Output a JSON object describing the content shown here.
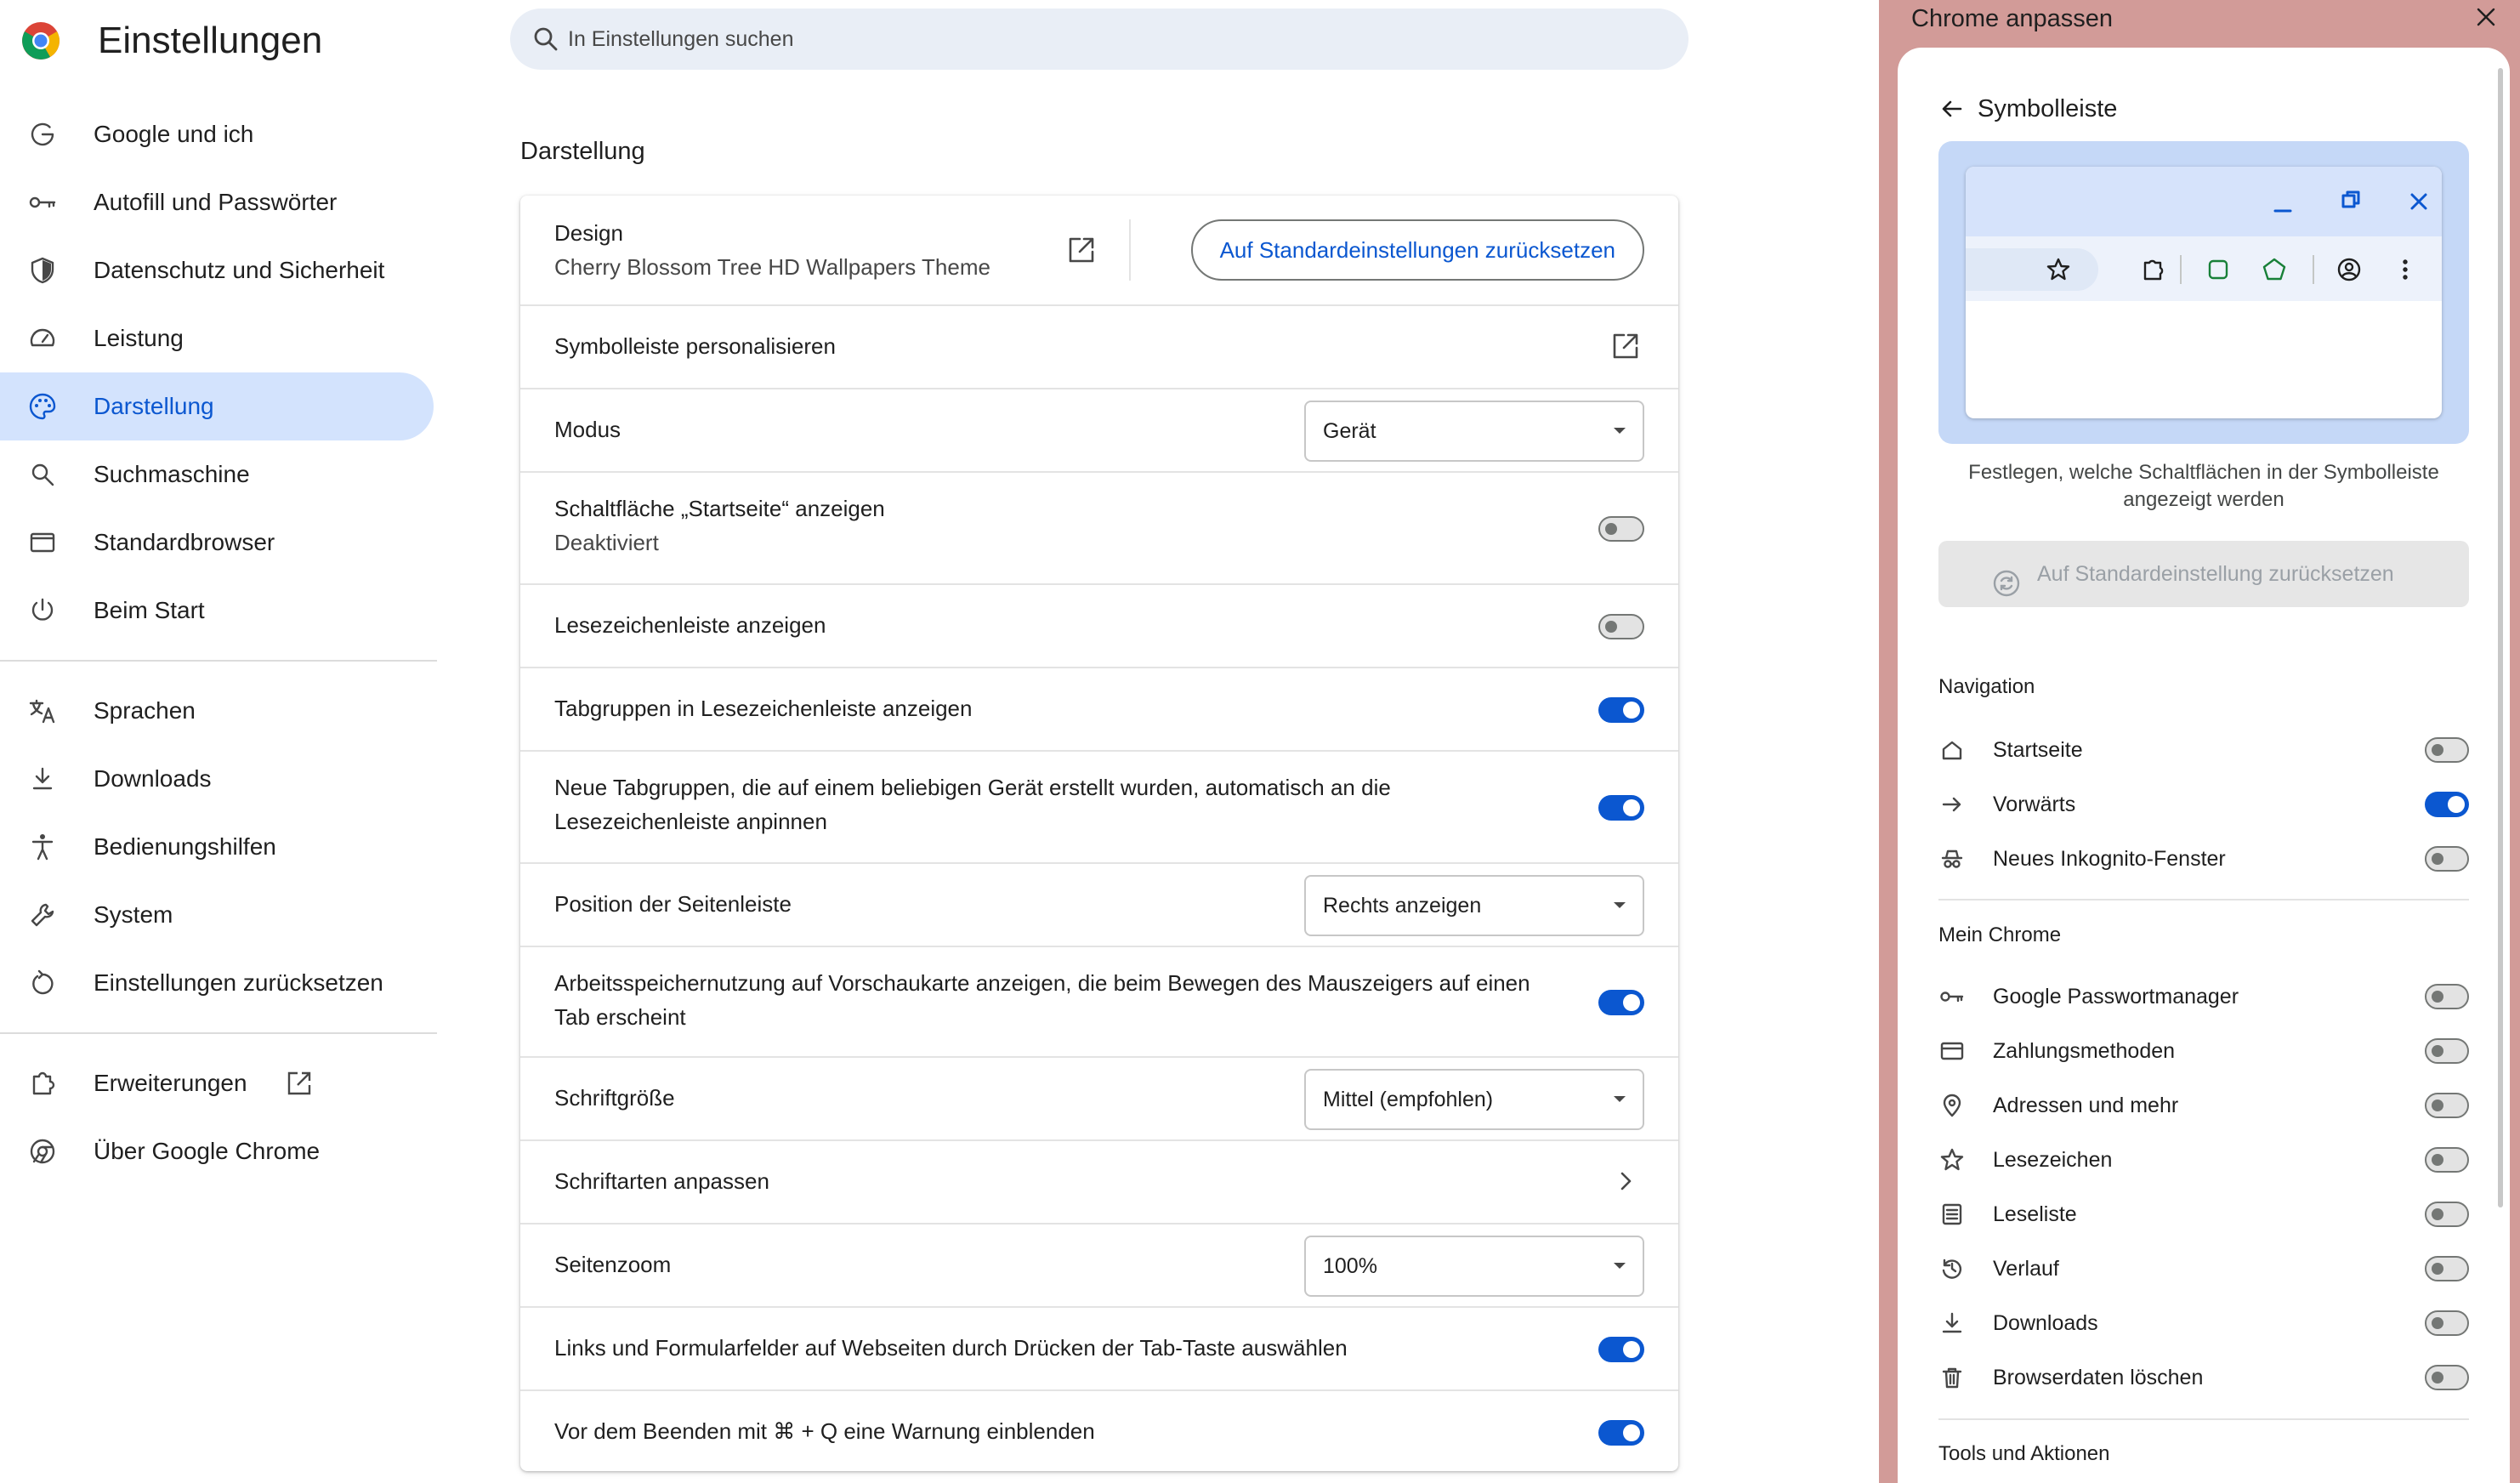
{
  "app": {
    "title": "Einstellungen"
  },
  "search": {
    "placeholder": "In Einstellungen suchen"
  },
  "nav": {
    "items": [
      {
        "label": "Google und ich",
        "icon": "google-g-icon"
      },
      {
        "label": "Autofill und Passwörter",
        "icon": "key-icon"
      },
      {
        "label": "Datenschutz und Sicherheit",
        "icon": "shield-icon"
      },
      {
        "label": "Leistung",
        "icon": "speedometer-icon"
      },
      {
        "label": "Darstellung",
        "icon": "palette-icon",
        "active": true
      },
      {
        "label": "Suchmaschine",
        "icon": "search-icon"
      },
      {
        "label": "Standardbrowser",
        "icon": "browser-window-icon"
      },
      {
        "label": "Beim Start",
        "icon": "power-icon"
      },
      {
        "label": "Sprachen",
        "icon": "translate-icon"
      },
      {
        "label": "Downloads",
        "icon": "download-icon"
      },
      {
        "label": "Bedienungshilfen",
        "icon": "accessibility-icon"
      },
      {
        "label": "System",
        "icon": "wrench-icon"
      },
      {
        "label": "Einstellungen zurücksetzen",
        "icon": "restore-icon"
      },
      {
        "label": "Erweiterungen",
        "icon": "puzzle-icon"
      },
      {
        "label": "Über Google Chrome",
        "icon": "chrome-icon"
      }
    ]
  },
  "main": {
    "section_title": "Darstellung",
    "design": {
      "label": "Design",
      "value": "Cherry Blossom Tree HD Wallpapers Theme",
      "reset_label": "Auf Standardeinstellungen zurücksetzen"
    },
    "toolbar_customize": "Symbolleiste personalisieren",
    "mode": {
      "label": "Modus",
      "value": "Gerät"
    },
    "home_button": {
      "label": "Schaltfläche „Startseite“ anzeigen",
      "sub": "Deaktiviert",
      "on": false
    },
    "bookmarks_bar": {
      "label": "Lesezeichenleiste anzeigen",
      "on": false
    },
    "tab_groups_bar": {
      "label": "Tabgruppen in Lesezeichenleiste anzeigen",
      "on": true
    },
    "pin_tab_groups": {
      "label": "Neue Tabgruppen, die auf einem beliebigen Gerät erstellt wurden, automatisch an die Lesezeichenleiste anpinnen",
      "on": true
    },
    "sidebar_position": {
      "label": "Position der Seitenleiste",
      "value": "Rechts anzeigen"
    },
    "memory_usage": {
      "label": "Arbeitsspeichernutzung auf Vorschaukarte anzeigen, die beim Bewegen des Mauszeigers auf einen Tab erscheint",
      "on": true
    },
    "font_size": {
      "label": "Schriftgröße",
      "value": "Mittel (empfohlen)"
    },
    "custom_fonts": {
      "label": "Schriftarten anpassen"
    },
    "page_zoom": {
      "label": "Seitenzoom",
      "value": "100%"
    },
    "tab_key": {
      "label": "Links und Formularfelder auf Webseiten durch Drücken der Tab-Taste auswählen",
      "on": true
    },
    "quit_warning": {
      "label": "Vor dem Beenden mit ⌘ + Q eine Warnung einblenden",
      "on": true
    }
  },
  "side_panel": {
    "title": "Chrome anpassen",
    "back_label": "Symbolleiste",
    "description": "Festlegen, welche Schaltflächen in der Symbolleiste angezeigt werden",
    "reset_label": "Auf Standardeinstellung zurücksetzen",
    "sections": [
      {
        "heading": "Navigation",
        "items": [
          {
            "label": "Startseite",
            "icon": "home-icon",
            "on": false
          },
          {
            "label": "Vorwärts",
            "icon": "arrow-forward-icon",
            "on": true
          },
          {
            "label": "Neues Inkognito-Fenster",
            "icon": "incognito-icon",
            "on": false
          }
        ]
      },
      {
        "heading": "Mein Chrome",
        "items": [
          {
            "label": "Google Passwortmanager",
            "icon": "key-icon",
            "on": false
          },
          {
            "label": "Zahlungsmethoden",
            "icon": "credit-card-icon",
            "on": false
          },
          {
            "label": "Adressen und mehr",
            "icon": "location-pin-icon",
            "on": false
          },
          {
            "label": "Lesezeichen",
            "icon": "star-icon",
            "on": false
          },
          {
            "label": "Leseliste",
            "icon": "reading-list-icon",
            "on": false
          },
          {
            "label": "Verlauf",
            "icon": "history-icon",
            "on": false
          },
          {
            "label": "Downloads",
            "icon": "download-icon",
            "on": false
          },
          {
            "label": "Browserdaten löschen",
            "icon": "trash-icon",
            "on": false
          }
        ]
      },
      {
        "heading": "Tools und Aktionen",
        "items": []
      }
    ]
  },
  "colors": {
    "accent": "#0b57d0",
    "active_nav_bg": "#d3e3fd",
    "side_panel_bg": "#d29b98",
    "preview_bg": "#c5d8f7"
  }
}
